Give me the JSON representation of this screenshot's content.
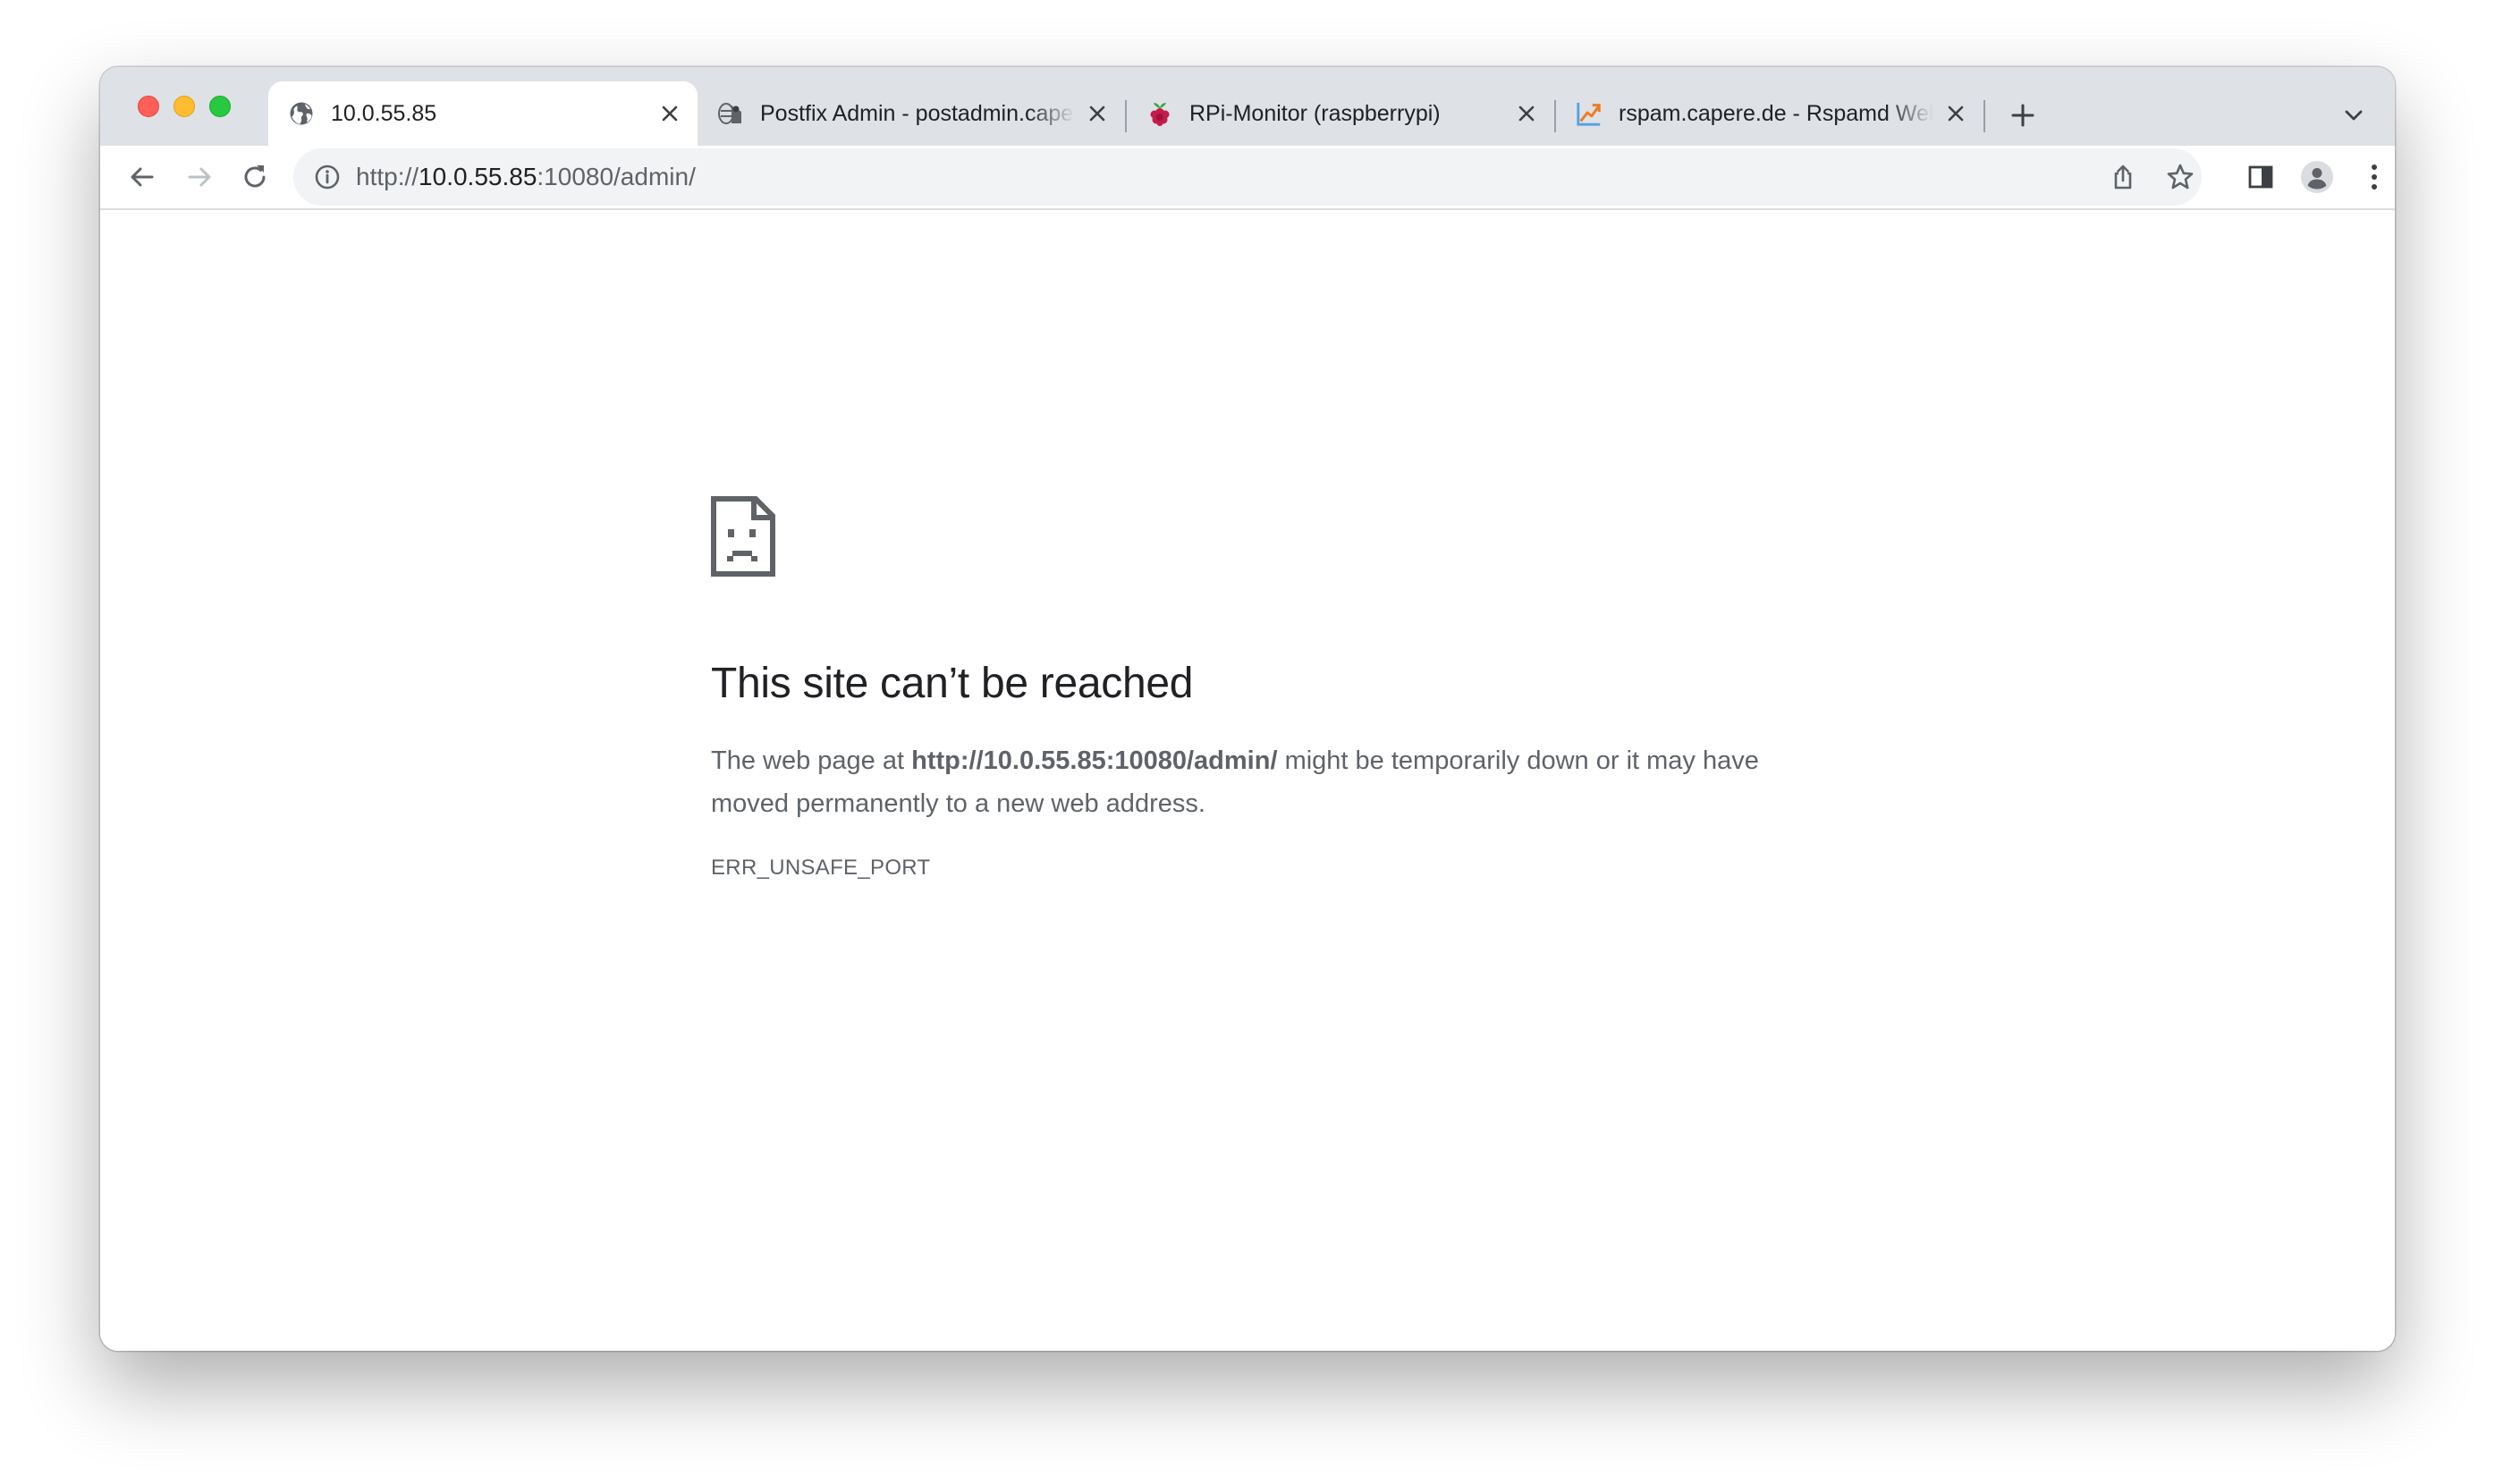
{
  "tabs": [
    {
      "title": "10.0.55.85",
      "favicon": "globe-icon",
      "active": true
    },
    {
      "title": "Postfix Admin - postadmin.capere.de",
      "favicon": "postfix-admin-icon",
      "active": false
    },
    {
      "title": "RPi-Monitor (raspberrypi)",
      "favicon": "raspberry-pi-icon",
      "active": false
    },
    {
      "title": "rspam.capere.de - Rspamd Web Interface",
      "favicon": "rspamd-icon",
      "active": false
    }
  ],
  "address_bar": {
    "scheme": "http://",
    "host": "10.0.55.85",
    "rest": ":10080/admin/"
  },
  "error": {
    "title": "This site can’t be reached",
    "body_prefix": "The web page at ",
    "body_url": "http://10.0.55.85:10080/admin/",
    "body_suffix": " might be temporarily down or it may have moved permanently to a new web address.",
    "code": "ERR_UNSAFE_PORT"
  },
  "colors": {
    "tabstrip": "#dee1e6",
    "omnibox": "#f1f3f4",
    "text_primary": "#202124",
    "text_secondary": "#5f6368",
    "icon": "#5f6368"
  }
}
